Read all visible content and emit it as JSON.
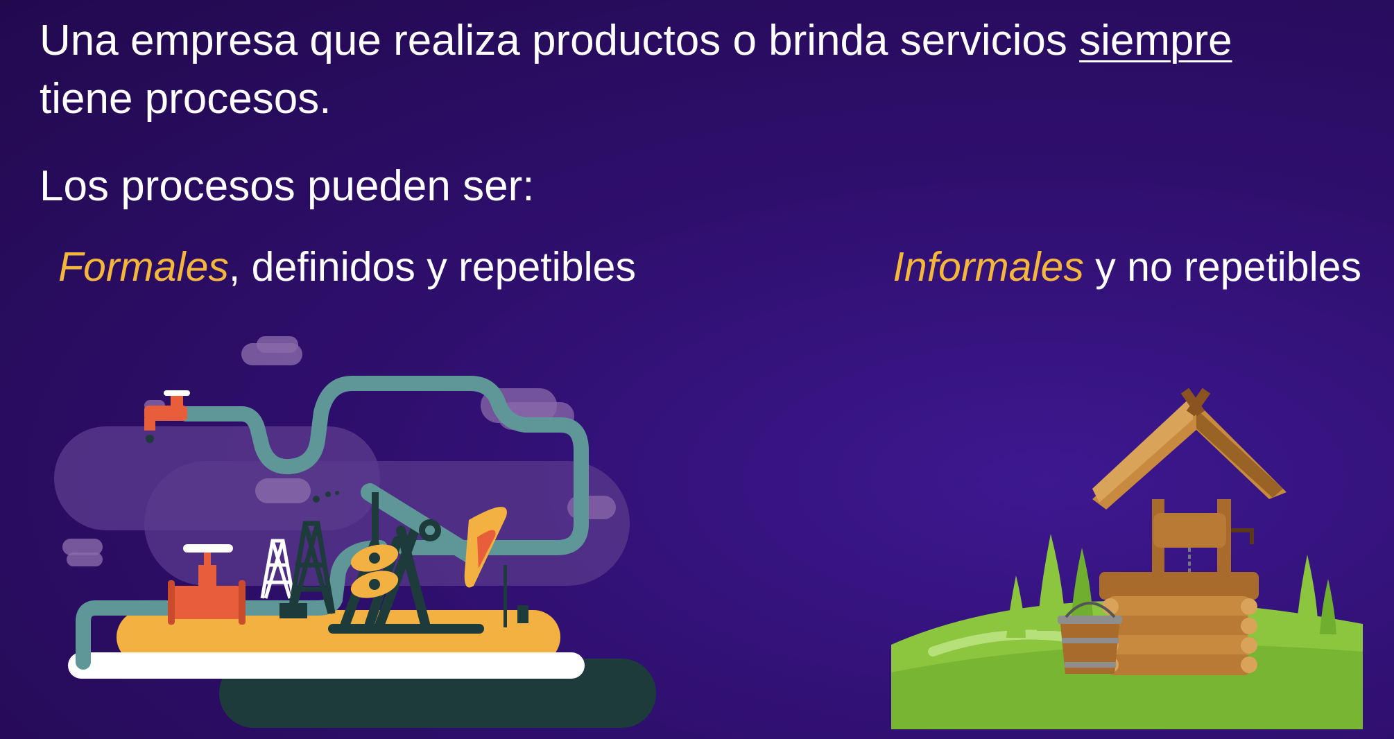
{
  "intro": {
    "line1": "Una empresa que realiza productos o brinda servicios ",
    "emphasis": "siempre",
    "line2": "tiene procesos."
  },
  "subtitle": "Los procesos pueden ser:",
  "formal": {
    "highlight": "Formales",
    "rest": ", definidos y repetibles"
  },
  "informal": {
    "highlight": "Informales",
    "rest": " y no repetibles"
  },
  "colors": {
    "highlight": "#f4b73c",
    "text": "#ffffff",
    "background": "#2a0c5e"
  },
  "illustrations": {
    "formal": "oil-pump-pipeline-illustration",
    "informal": "wooden-water-well-illustration"
  }
}
